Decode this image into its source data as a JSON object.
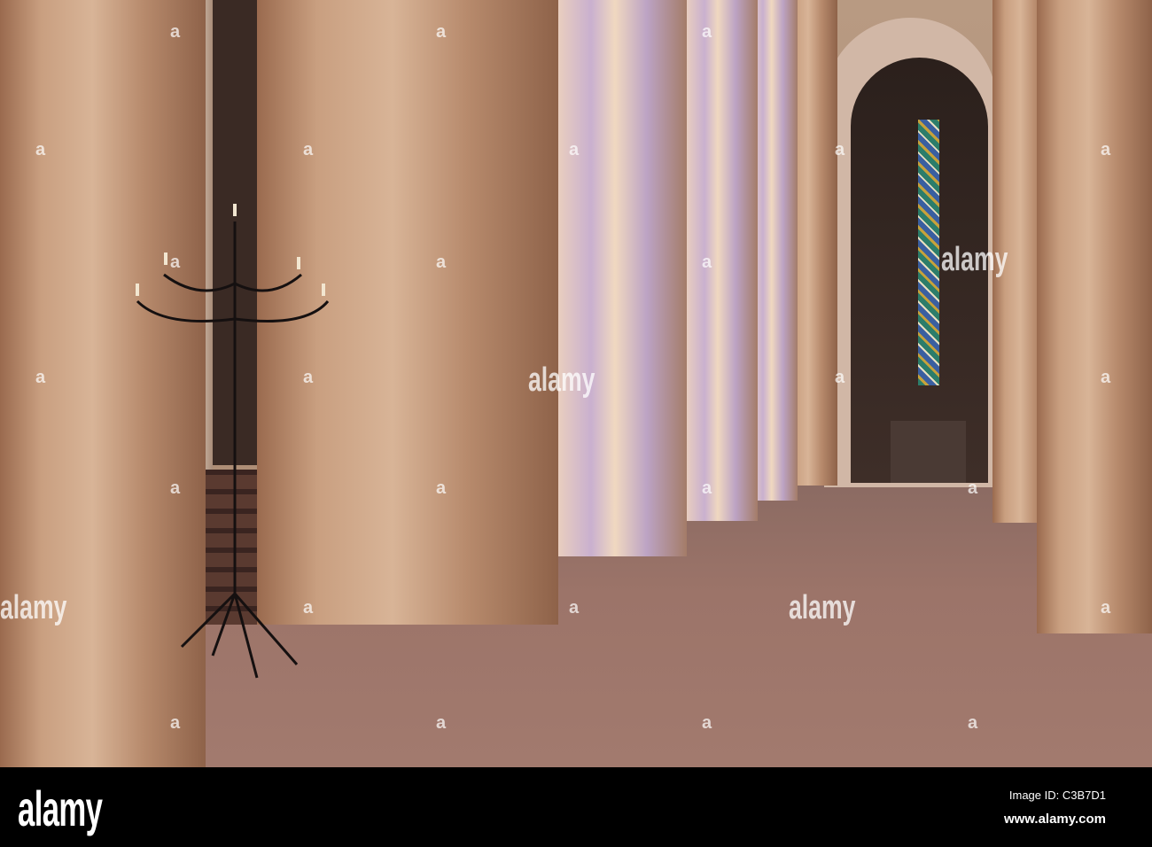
{
  "watermark": {
    "large": "alamy",
    "small": "a"
  },
  "footer": {
    "logo": "alamy",
    "image_id": "Image ID: C3B7D1",
    "url": "www.alamy.com"
  }
}
